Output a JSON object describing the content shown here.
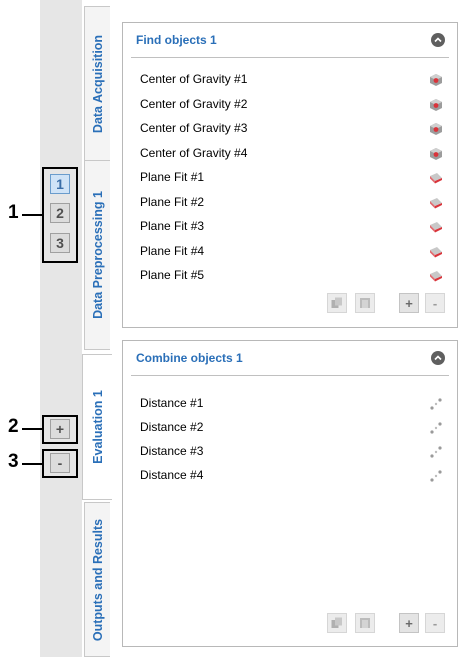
{
  "pager": {
    "pages": [
      "1",
      "2",
      "3"
    ],
    "active_page": "1",
    "add_label": "+",
    "remove_label": "-"
  },
  "callouts": [
    "1",
    "2",
    "3"
  ],
  "tabs": [
    {
      "label": "Data Acquisition"
    },
    {
      "label": "Data Preprocessing 1"
    },
    {
      "label": "Evaluation 1"
    },
    {
      "label": "Outputs and Results"
    }
  ],
  "panels": [
    {
      "title": "Find objects 1",
      "items": [
        {
          "label": "Center of Gravity #1",
          "icon": "center-of-gravity-icon"
        },
        {
          "label": "Center of Gravity #2",
          "icon": "center-of-gravity-icon"
        },
        {
          "label": "Center of Gravity #3",
          "icon": "center-of-gravity-icon"
        },
        {
          "label": "Center of Gravity #4",
          "icon": "center-of-gravity-icon"
        },
        {
          "label": "Plane Fit #1",
          "icon": "plane-fit-icon"
        },
        {
          "label": "Plane Fit #2",
          "icon": "plane-fit-icon"
        },
        {
          "label": "Plane Fit #3",
          "icon": "plane-fit-icon"
        },
        {
          "label": "Plane Fit #4",
          "icon": "plane-fit-icon"
        },
        {
          "label": "Plane Fit #5",
          "icon": "plane-fit-icon"
        }
      ],
      "add_label": "+",
      "remove_label": "-"
    },
    {
      "title": "Combine objects 1",
      "items": [
        {
          "label": "Distance #1",
          "icon": "distance-icon"
        },
        {
          "label": "Distance #2",
          "icon": "distance-icon"
        },
        {
          "label": "Distance #3",
          "icon": "distance-icon"
        },
        {
          "label": "Distance #4",
          "icon": "distance-icon"
        }
      ],
      "add_label": "+",
      "remove_label": "-"
    }
  ],
  "colors": {
    "tab_text": "#2a6fb8",
    "panel_title": "#2a6fb8",
    "active_page_bg": "#cfe3f7"
  }
}
